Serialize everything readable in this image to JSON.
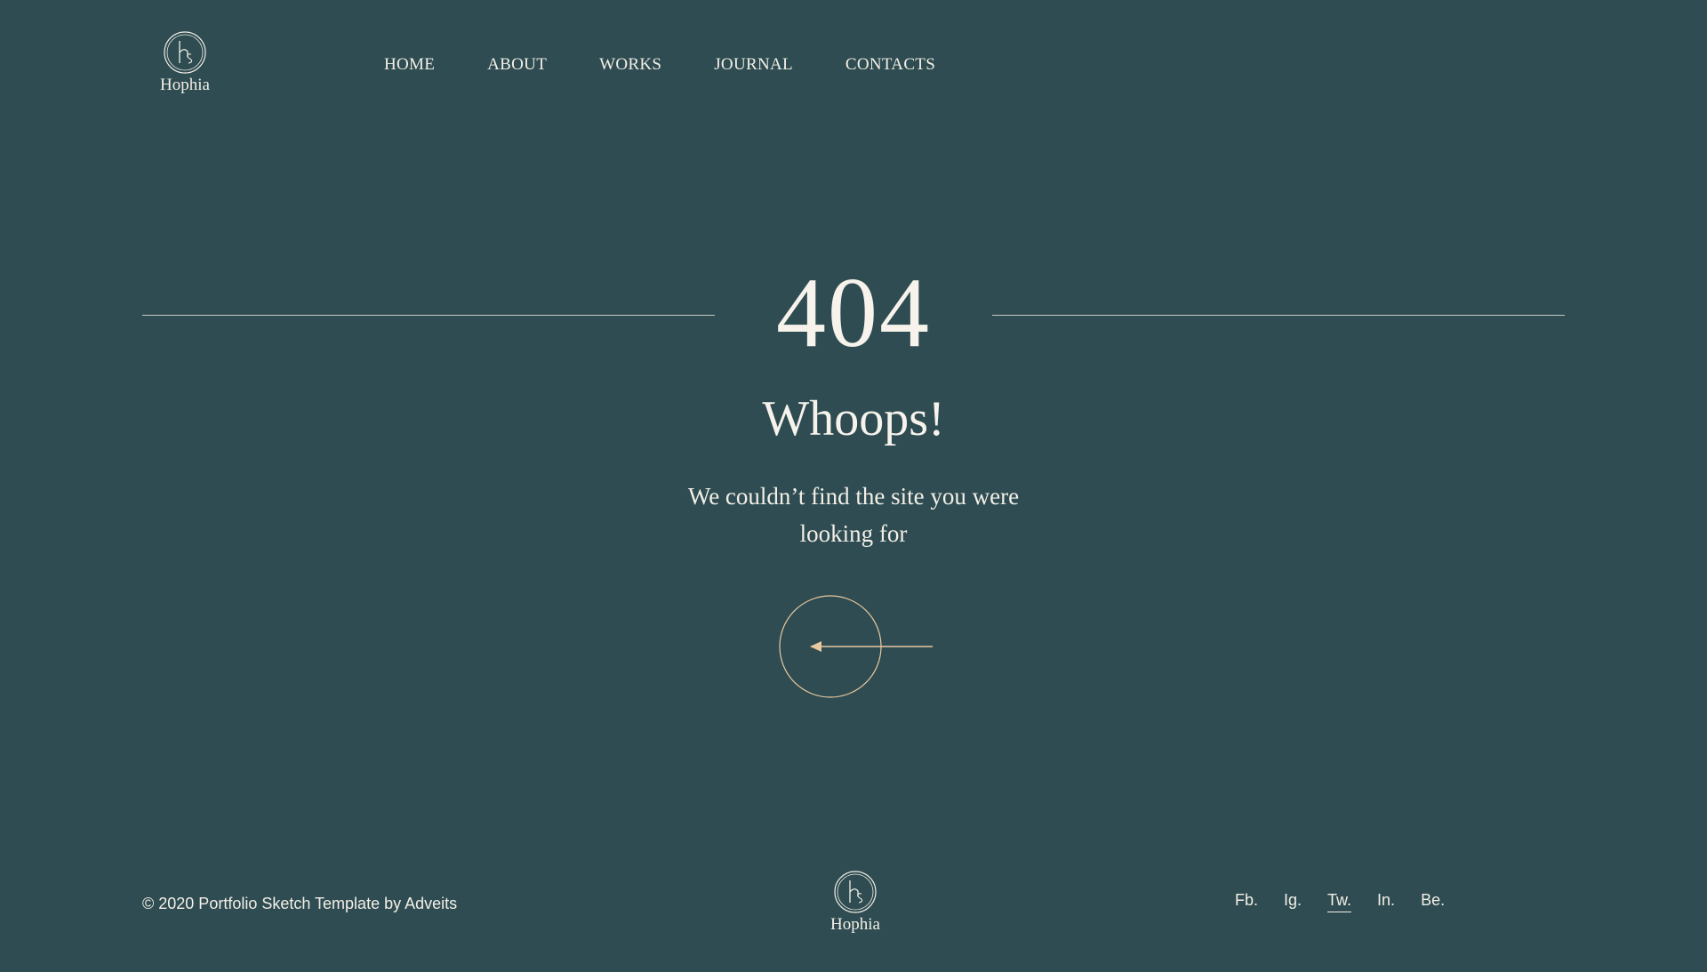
{
  "header": {
    "logo": {
      "icon": "hs-monogram-icon",
      "text": "Hophia"
    },
    "nav": [
      {
        "label": "HOME",
        "name": "nav-home"
      },
      {
        "label": "ABOUT",
        "name": "nav-about"
      },
      {
        "label": "WORKS",
        "name": "nav-works"
      },
      {
        "label": "JOURNAL",
        "name": "nav-journal"
      },
      {
        "label": "CONTACTS",
        "name": "nav-contacts"
      }
    ]
  },
  "error": {
    "code": "404",
    "headline": "Whoops!",
    "message": "We couldn’t find the site you were looking for",
    "back_icon": "arrow-left-icon"
  },
  "footer": {
    "copyright": "© 2020 Portfolio Sketch Template by Adveits",
    "logo": {
      "icon": "hs-monogram-icon",
      "text": "Hophia"
    },
    "social": [
      {
        "label": "Fb.",
        "name": "social-facebook",
        "active": false
      },
      {
        "label": "Ig.",
        "name": "social-instagram",
        "active": false
      },
      {
        "label": "Tw.",
        "name": "social-twitter",
        "active": true
      },
      {
        "label": "In.",
        "name": "social-linkedin",
        "active": false
      },
      {
        "label": "Be.",
        "name": "social-behance",
        "active": false
      }
    ]
  },
  "colors": {
    "background": "#2e4c51",
    "text": "#f3efe7",
    "accent": "#e9c8a0",
    "rule": "#c9c8bf"
  }
}
